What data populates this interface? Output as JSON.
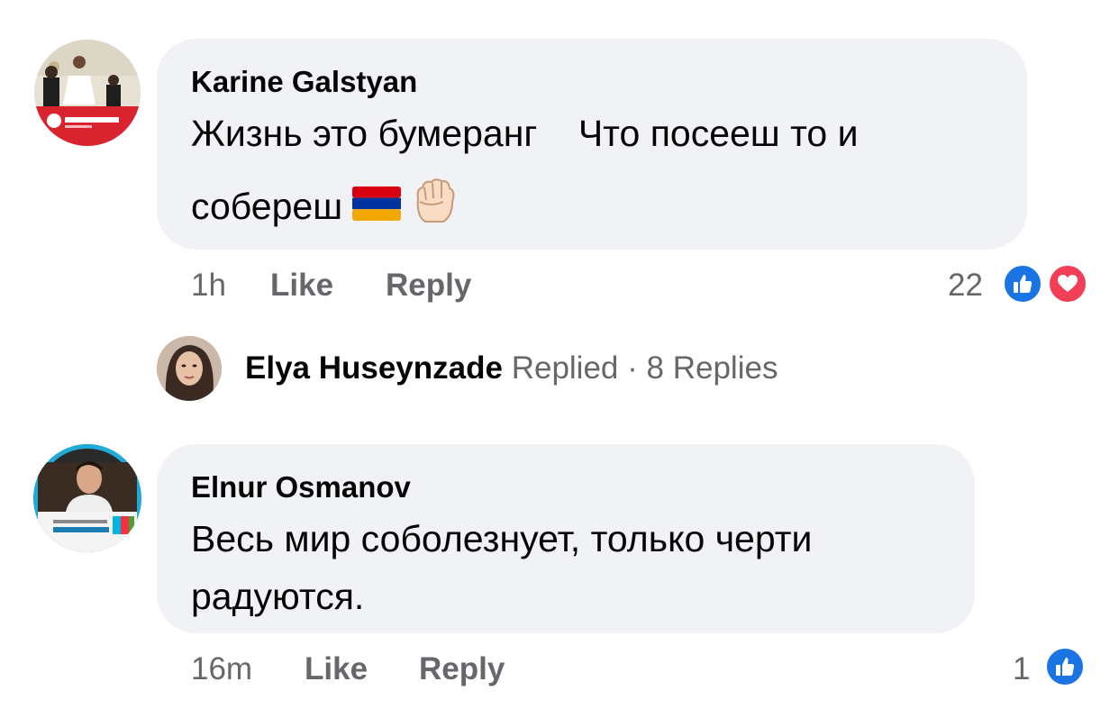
{
  "comments": [
    {
      "author": "Karine Galstyan",
      "text_line1": "Жизнь это бумеранг    Что посееш то и",
      "text_line2": "собереш",
      "emojis": [
        "armenia-flag",
        "raised-fist-light-skin"
      ],
      "time": "1h",
      "like_label": "Like",
      "reply_label": "Reply",
      "reaction_count": "22",
      "reactions": [
        "like",
        "love"
      ],
      "avatar_colors": {
        "bg": "#e8e2d4",
        "band": "#d9232e"
      }
    },
    {
      "author": "Elnur Osmanov",
      "text_line1": "Весь мир соболезнует, только черти",
      "text_line2": "радуются.",
      "time": "16m",
      "like_label": "Like",
      "reply_label": "Reply",
      "reaction_count": "1",
      "reactions": [
        "like"
      ],
      "avatar_colors": {
        "bg": "#2b2b2b",
        "ring": "#1faad7"
      }
    }
  ],
  "reply_summary": {
    "name": "Elya Huseynzade",
    "action": "Replied",
    "separator": "·",
    "count": "8 Replies"
  },
  "colors": {
    "bubble": "#f0f2f5",
    "meta_text": "#65676b",
    "like_blue": "#1b74e4",
    "love_red": "#f33e58"
  }
}
